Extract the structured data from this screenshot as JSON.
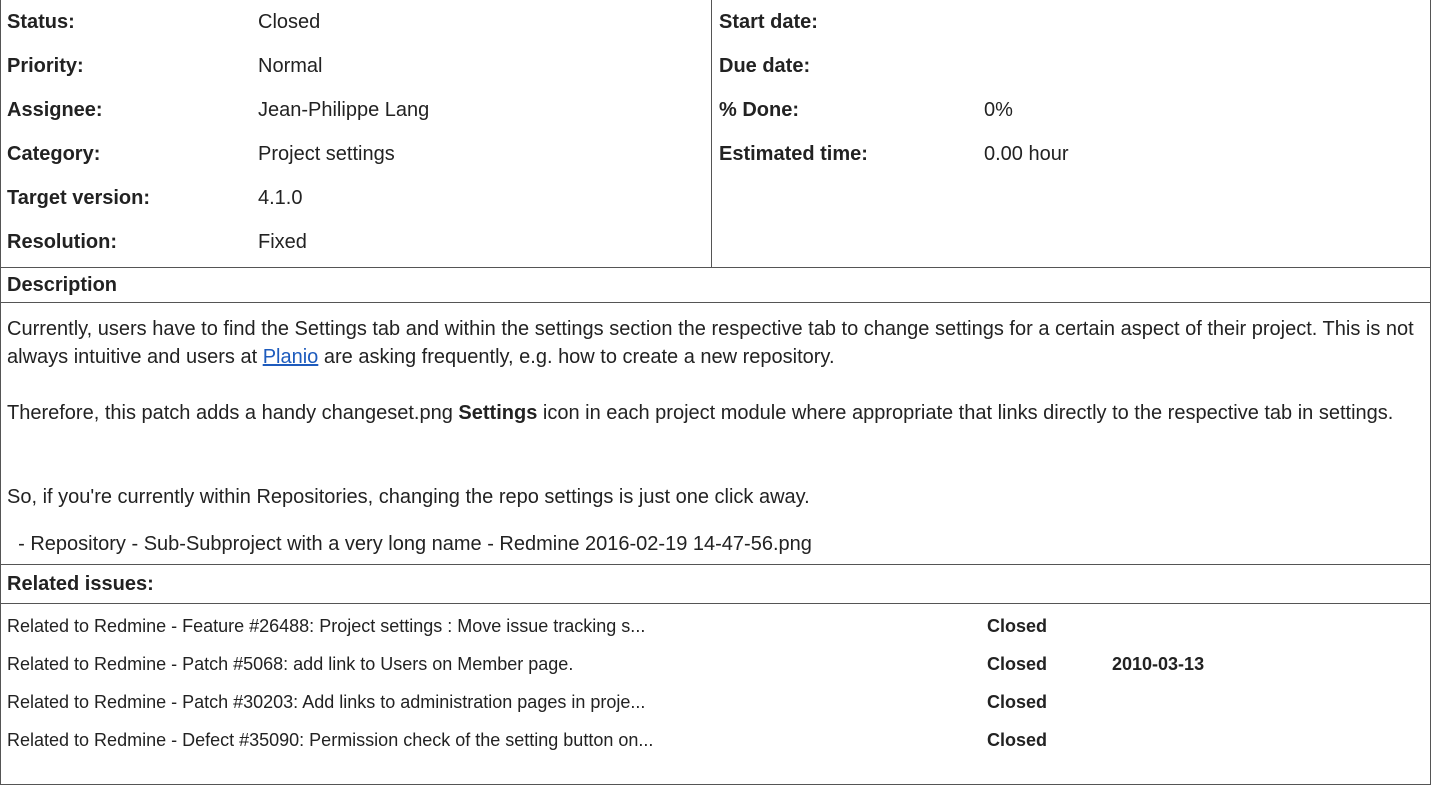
{
  "attributes_left": [
    {
      "label": "Status:",
      "value": "Closed"
    },
    {
      "label": "Priority:",
      "value": "Normal"
    },
    {
      "label": "Assignee:",
      "value": "Jean-Philippe Lang"
    },
    {
      "label": "Category:",
      "value": "Project settings"
    },
    {
      "label": "Target version:",
      "value": "4.1.0"
    },
    {
      "label": "Resolution:",
      "value": "Fixed"
    }
  ],
  "attributes_right": [
    {
      "label": "Start date:",
      "value": ""
    },
    {
      "label": "Due date:",
      "value": ""
    },
    {
      "label": "% Done:",
      "value": "0%"
    },
    {
      "label": "Estimated time:",
      "value": "0.00 hour"
    }
  ],
  "description": {
    "title": "Description",
    "p1_before": "Currently, users have to find the Settings tab and within the settings section the respective tab to change settings for a certain aspect of their project. This is not always intuitive and users at ",
    "p1_link": "Planio",
    "p1_after": " are asking frequently, e.g. how to create a new repository.",
    "p2_before": "Therefore, this patch adds a handy  changeset.png ",
    "p2_bold": "Settings",
    "p2_after": " icon in each project module where appropriate that links directly to the respective tab in settings.",
    "p3": "So, if you're currently within Repositories, changing the repo settings is just one click away.",
    "attachment": "  - Repository - Sub-Subproject with a very long name - Redmine 2016-02-19 14-47-56.png"
  },
  "related": {
    "title": "Related issues:",
    "rows": [
      {
        "subject": "Related to Redmine - Feature #26488: Project settings : Move issue tracking s...",
        "status": "Closed",
        "date": ""
      },
      {
        "subject": "Related to Redmine - Patch #5068: add link to Users on Member page.",
        "status": "Closed",
        "date": "2010-03-13"
      },
      {
        "subject": "Related to Redmine - Patch #30203: Add links to administration pages in proje...",
        "status": "Closed",
        "date": ""
      },
      {
        "subject": "Related to Redmine - Defect #35090: Permission check of the setting button on...",
        "status": "Closed",
        "date": ""
      }
    ]
  }
}
